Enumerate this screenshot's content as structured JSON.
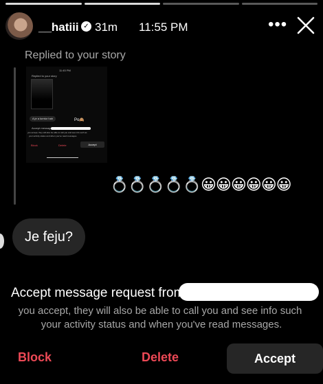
{
  "header": {
    "username": "__hatiii",
    "verified_mark": "✓",
    "age": "31m",
    "time": "11:55 PM",
    "more_icon": "more-icon",
    "close_icon": "close-icon"
  },
  "reply": {
    "label": "Replied to your story",
    "screenshot": {
      "time": "11:45 PM",
      "replied_label": "Replied to your story",
      "message": "A je a lumtur hah",
      "emoji_text": "Po🙈",
      "request_title": "Accept message request",
      "request_desc_1": "you accept, they will also be able to call you and see info such as",
      "request_desc_2": "your activity status and when you've read messages.",
      "block": "Block",
      "delete": "Delete",
      "accept": "Accept"
    },
    "emojis": "💍💍💍💍💍😀😀😀😀😀😀"
  },
  "message": {
    "text": "Je feju?"
  },
  "request": {
    "title": "Accept message request from",
    "desc_line1": "you accept, they will also be able to call you and see info such",
    "desc_line2": "your activity status and when you've read messages."
  },
  "actions": {
    "block": "Block",
    "delete": "Delete",
    "accept": "Accept"
  },
  "colors": {
    "danger": "#ed4956",
    "bubble": "#262626",
    "secondary_text": "#a8a8a8"
  }
}
